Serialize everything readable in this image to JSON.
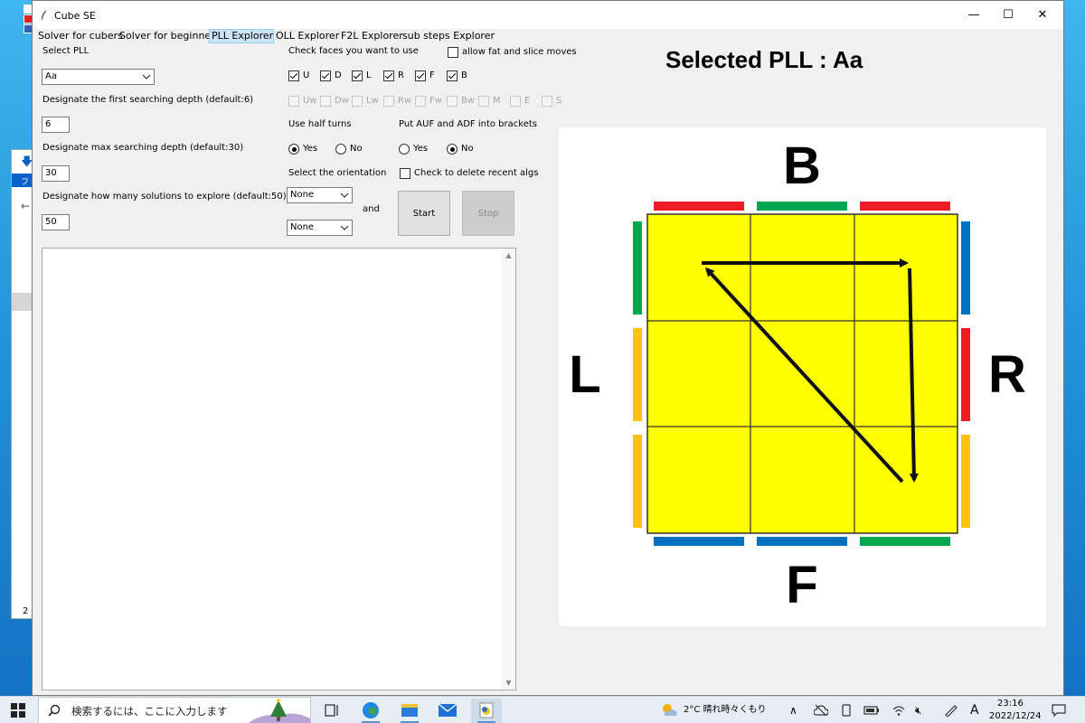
{
  "window": {
    "title": "Cube SE",
    "controls": {
      "minimize": "—",
      "maximize": "☐",
      "close": "✕"
    }
  },
  "menu": [
    "Solver for cubers",
    "Solver for beginners",
    "PLL Explorer",
    "OLL Explorer",
    "F2L Explorer",
    "sub steps Explorer"
  ],
  "left": {
    "select_pll_label": "Select PLL",
    "pll_value": "Aa",
    "first_depth_label": "Designate the first searching depth (default:6)",
    "first_depth_value": "6",
    "max_depth_label": "Designate max searching depth (default:30)",
    "max_depth_value": "30",
    "solutions_label": "Designate how many solutions to explore (default:50)",
    "solutions_value": "50"
  },
  "faces": {
    "label": "Check faces you want to use",
    "fat_label": "allow fat and slice moves",
    "fat_checked": false,
    "basic": [
      {
        "label": "U",
        "checked": true
      },
      {
        "label": "D",
        "checked": true
      },
      {
        "label": "L",
        "checked": true
      },
      {
        "label": "R",
        "checked": true
      },
      {
        "label": "F",
        "checked": true
      },
      {
        "label": "B",
        "checked": true
      }
    ],
    "advanced": [
      {
        "label": "Uw"
      },
      {
        "label": "Dw"
      },
      {
        "label": "Lw"
      },
      {
        "label": "Rw"
      },
      {
        "label": "Fw"
      },
      {
        "label": "Bw"
      },
      {
        "label": "M"
      },
      {
        "label": "E"
      },
      {
        "label": "S"
      }
    ]
  },
  "half_turns": {
    "label": "Use half turns",
    "yes": "Yes",
    "no": "No",
    "selected": "Yes"
  },
  "brackets": {
    "label": "Put AUF and ADF into brackets",
    "yes": "Yes",
    "no": "No",
    "selected": "No"
  },
  "orientation": {
    "label": "Select the orientation",
    "first": "None",
    "second": "None",
    "and_label": "and"
  },
  "delete_recent": {
    "label": "Check to delete recent algs",
    "checked": false
  },
  "buttons": {
    "start": "Start",
    "stop": "Stop"
  },
  "selected_pll_title": "Selected PLL : Aa",
  "diagram": {
    "labels": {
      "top": "B",
      "left": "L",
      "right": "R",
      "bottom": "F"
    },
    "colors": {
      "yellow": "#ffff00",
      "red": "#ee1c24",
      "green": "#00a650",
      "blue": "#0070c0",
      "orange": "#ffc20e"
    },
    "top_stickers": [
      "red",
      "green",
      "red"
    ],
    "bottom_stickers": [
      "blue",
      "blue",
      "green"
    ],
    "left_stickers": [
      "green",
      "orange",
      "orange"
    ],
    "right_stickers": [
      "blue",
      "red",
      "orange"
    ]
  },
  "behind_window": {
    "tab_text": "ファ",
    "bottom_text": "2"
  },
  "taskbar": {
    "search_placeholder": "検索するには、ここに入力します",
    "weather": "2°C  晴れ時々くもり",
    "ime": "A",
    "time": "23:16",
    "date": "2022/12/24"
  }
}
